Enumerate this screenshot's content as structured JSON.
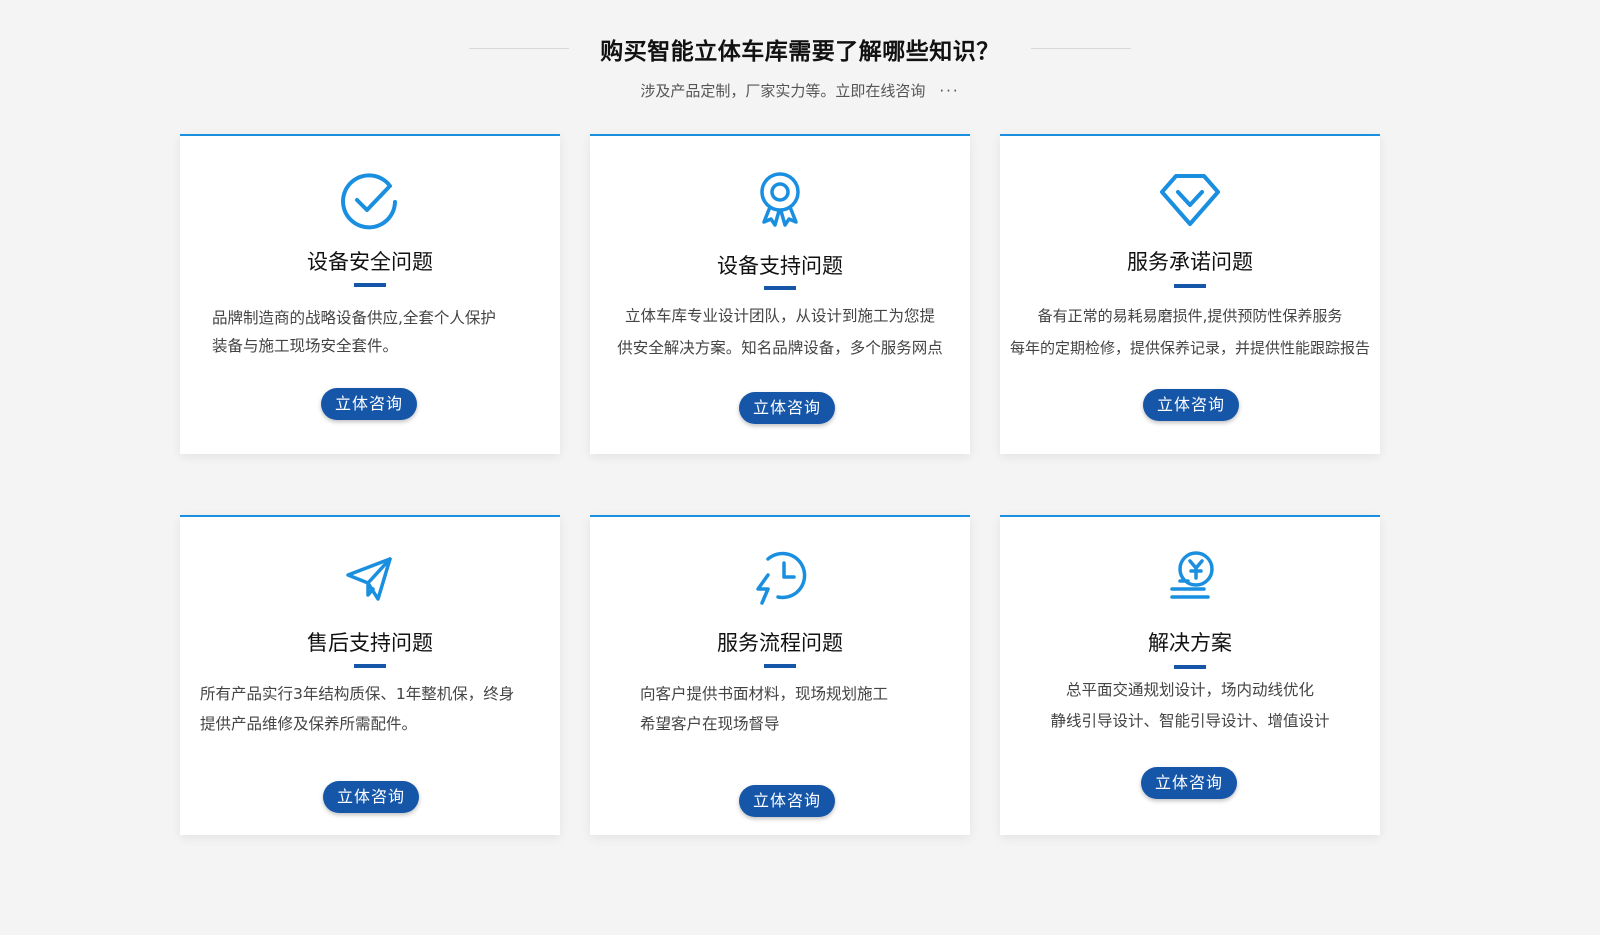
{
  "header": {
    "title": "购买智能立体车库需要了解哪些知识？",
    "subtitle": "涉及产品定制，厂家实力等。立即在线咨询",
    "dots": "···"
  },
  "accent_color": "#1a8fe0",
  "button_color": "#1656a8",
  "cards": [
    {
      "icon": "check-circle-icon",
      "title": "设备安全问题",
      "desc_lines": [
        "品牌制造商的战略设备供应,全套个人保护",
        "装备与施工现场安全套件。"
      ],
      "button": "立体咨询"
    },
    {
      "icon": "award-medal-icon",
      "title": "设备支持问题",
      "desc_lines": [
        "立体车库专业设计团队，从设计到施工为您提",
        "供安全解决方案。知名品牌设备，多个服务网点"
      ],
      "button": "立体咨询"
    },
    {
      "icon": "diamond-icon",
      "title": "服务承诺问题",
      "desc_lines": [
        "备有正常的易耗易磨损件,提供预防性保养服务",
        "每年的定期检修，提供保养记录，并提供性能跟踪报告"
      ],
      "button": "立体咨询"
    },
    {
      "icon": "paper-plane-icon",
      "title": "售后支持问题",
      "desc_lines": [
        "所有产品实行3年结构质保、1年整机保，终身",
        "提供产品维修及保养所需配件。"
      ],
      "button": "立体咨询"
    },
    {
      "icon": "clock-lightning-icon",
      "title": "服务流程问题",
      "desc_lines": [
        "向客户提供书面材料，现场规划施工",
        "希望客户在现场督导"
      ],
      "button": "立体咨询"
    },
    {
      "icon": "coin-yuan-icon",
      "title": "解决方案",
      "desc_lines": [
        "总平面交通规划设计，场内动线优化",
        "静线引导设计、智能引导设计、增值设计"
      ],
      "button": "立体咨询"
    }
  ]
}
